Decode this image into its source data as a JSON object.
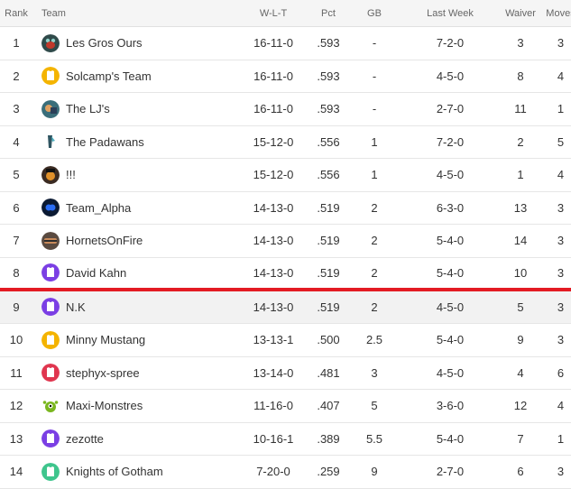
{
  "headers": {
    "rank": "Rank",
    "team": "Team",
    "wlt": "W-L-T",
    "pct": "Pct",
    "gb": "GB",
    "last_week": "Last Week",
    "waiver": "Waiver",
    "moves": "Moves"
  },
  "colors": {
    "playoff_line": "#e31b23",
    "highlight_row": "#f2f2f2"
  },
  "rows": [
    {
      "rank": "1",
      "team": "Les Gros Ours",
      "logo": "bear-team-logo-icon",
      "wlt": "16-11-0",
      "pct": ".593",
      "gb": "-",
      "last_week": "7-2-0",
      "waiver": "3",
      "moves": "3"
    },
    {
      "rank": "2",
      "team": "Solcamp's Team",
      "logo": "jersey-team-logo-icon",
      "wlt": "16-11-0",
      "pct": ".593",
      "gb": "-",
      "last_week": "4-5-0",
      "waiver": "8",
      "moves": "4"
    },
    {
      "rank": "3",
      "team": "The LJ's",
      "logo": "photo-team-logo-icon",
      "wlt": "16-11-0",
      "pct": ".593",
      "gb": "-",
      "last_week": "2-7-0",
      "waiver": "11",
      "moves": "1"
    },
    {
      "rank": "4",
      "team": "The Padawans",
      "logo": "padawan-team-logo-icon",
      "wlt": "15-12-0",
      "pct": ".556",
      "gb": "1",
      "last_week": "7-2-0",
      "waiver": "2",
      "moves": "5"
    },
    {
      "rank": "5",
      "team": "!!!",
      "logo": "face-team-logo-icon",
      "wlt": "15-12-0",
      "pct": ".556",
      "gb": "1",
      "last_week": "4-5-0",
      "waiver": "1",
      "moves": "4"
    },
    {
      "rank": "6",
      "team": "Team_Alpha",
      "logo": "alpha-team-logo-icon",
      "wlt": "14-13-0",
      "pct": ".519",
      "gb": "2",
      "last_week": "6-3-0",
      "waiver": "13",
      "moves": "3"
    },
    {
      "rank": "7",
      "team": "HornetsOnFire",
      "logo": "hornets-team-logo-icon",
      "wlt": "14-13-0",
      "pct": ".519",
      "gb": "2",
      "last_week": "5-4-0",
      "waiver": "14",
      "moves": "3"
    },
    {
      "rank": "8",
      "team": "David Kahn",
      "logo": "jersey-team-logo-icon",
      "wlt": "14-13-0",
      "pct": ".519",
      "gb": "2",
      "last_week": "5-4-0",
      "waiver": "10",
      "moves": "3"
    },
    {
      "rank": "9",
      "team": "N.K",
      "logo": "jersey-team-logo-icon",
      "wlt": "14-13-0",
      "pct": ".519",
      "gb": "2",
      "last_week": "4-5-0",
      "waiver": "5",
      "moves": "3"
    },
    {
      "rank": "10",
      "team": "Minny Mustang",
      "logo": "jersey-team-logo-icon",
      "wlt": "13-13-1",
      "pct": ".500",
      "gb": "2.5",
      "last_week": "5-4-0",
      "waiver": "9",
      "moves": "3"
    },
    {
      "rank": "11",
      "team": "stephyx-spree",
      "logo": "jersey-team-logo-icon",
      "wlt": "13-14-0",
      "pct": ".481",
      "gb": "3",
      "last_week": "4-5-0",
      "waiver": "4",
      "moves": "6"
    },
    {
      "rank": "12",
      "team": "Maxi-Monstres",
      "logo": "monster-team-logo-icon",
      "wlt": "11-16-0",
      "pct": ".407",
      "gb": "5",
      "last_week": "3-6-0",
      "waiver": "12",
      "moves": "4"
    },
    {
      "rank": "13",
      "team": "zezotte",
      "logo": "jersey-team-logo-icon",
      "wlt": "10-16-1",
      "pct": ".389",
      "gb": "5.5",
      "last_week": "5-4-0",
      "waiver": "7",
      "moves": "1"
    },
    {
      "rank": "14",
      "team": "Knights of Gotham",
      "logo": "jersey-team-logo-icon",
      "wlt": "7-20-0",
      "pct": ".259",
      "gb": "9",
      "last_week": "2-7-0",
      "waiver": "6",
      "moves": "3"
    }
  ]
}
